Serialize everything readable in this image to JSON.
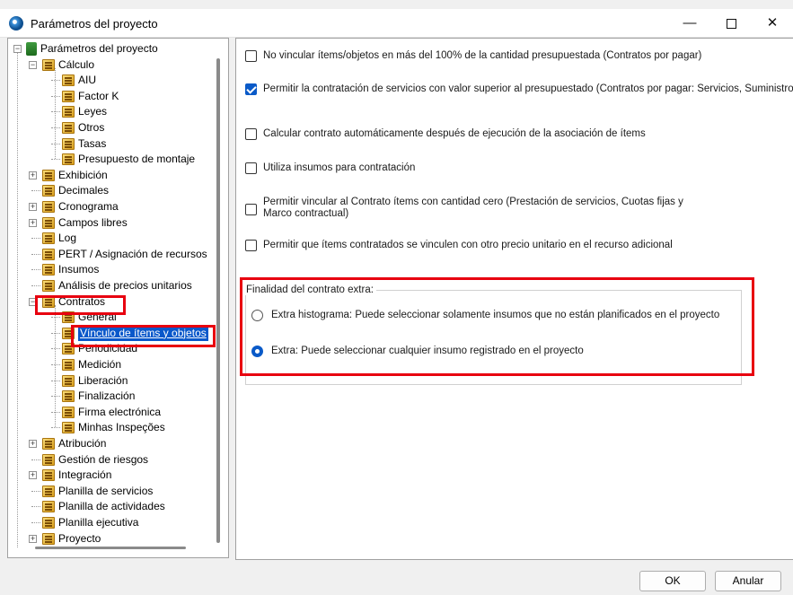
{
  "window": {
    "title": "Parámetros del proyecto",
    "controls": {
      "minimize": "—",
      "close": "✕"
    }
  },
  "tree": {
    "root": "Parámetros del proyecto",
    "items": [
      {
        "label": "Cálculo",
        "expander": "−"
      },
      {
        "label": "AIU"
      },
      {
        "label": "Factor K"
      },
      {
        "label": "Leyes"
      },
      {
        "label": "Otros"
      },
      {
        "label": "Tasas"
      },
      {
        "label": "Presupuesto de montaje"
      },
      {
        "label": "Exhibición",
        "expander": "+"
      },
      {
        "label": "Decimales"
      },
      {
        "label": "Cronograma",
        "expander": "+"
      },
      {
        "label": "Campos libres",
        "expander": "+"
      },
      {
        "label": "Log"
      },
      {
        "label": "PERT / Asignación de recursos"
      },
      {
        "label": "Insumos"
      },
      {
        "label": "Análisis de precios unitarios"
      },
      {
        "label": "Contratos",
        "expander": "−"
      },
      {
        "label": "General"
      },
      {
        "label": "Vínculo de ítems y objetos"
      },
      {
        "label": "Periodicidad"
      },
      {
        "label": "Medición"
      },
      {
        "label": "Liberación"
      },
      {
        "label": "Finalización"
      },
      {
        "label": "Firma electrónica"
      },
      {
        "label": "Minhas Inspeções"
      },
      {
        "label": "Atribución",
        "expander": "+"
      },
      {
        "label": "Gestión de riesgos"
      },
      {
        "label": "Integración",
        "expander": "+"
      },
      {
        "label": "Planilla de servicios"
      },
      {
        "label": "Planilla de actividades"
      },
      {
        "label": "Planilla ejecutiva"
      },
      {
        "label": "Proyecto",
        "expander": "+"
      }
    ]
  },
  "options": [
    {
      "label": "No vincular ítems/objetos en más del 100% de la cantidad presupuestada (Contratos por pagar)",
      "checked": false
    },
    {
      "label": "Permitir la contratación de servicios con valor superior al presupuestado (Contratos por pagar: Servicios, Suministro",
      "checked": true
    },
    {
      "label": "Calcular contrato automáticamente después de ejecución de la asociación de ítems",
      "checked": false
    },
    {
      "label": "Utiliza insumos para contratación",
      "checked": false
    },
    {
      "label": "Permitir vincular al Contrato ítems con cantidad cero (Prestación de servicios, Cuotas fijas y",
      "label2": "Marco contractual)",
      "checked": false
    },
    {
      "label": "Permitir que ítems contratados se vinculen con otro precio unitario en el recurso adicional",
      "checked": false
    }
  ],
  "extra_group": {
    "title": "Finalidad del contrato extra:",
    "options": [
      {
        "label": "Extra histograma: Puede seleccionar solamente insumos que no están planificados en el proyecto",
        "selected": false
      },
      {
        "label": "Extra: Puede seleccionar cualquier insumo registrado en el proyecto",
        "selected": true
      }
    ]
  },
  "buttons": {
    "ok": "OK",
    "cancel": "Anular"
  },
  "colors": {
    "highlight": "#e8000f",
    "accent": "#0a5ac8"
  }
}
